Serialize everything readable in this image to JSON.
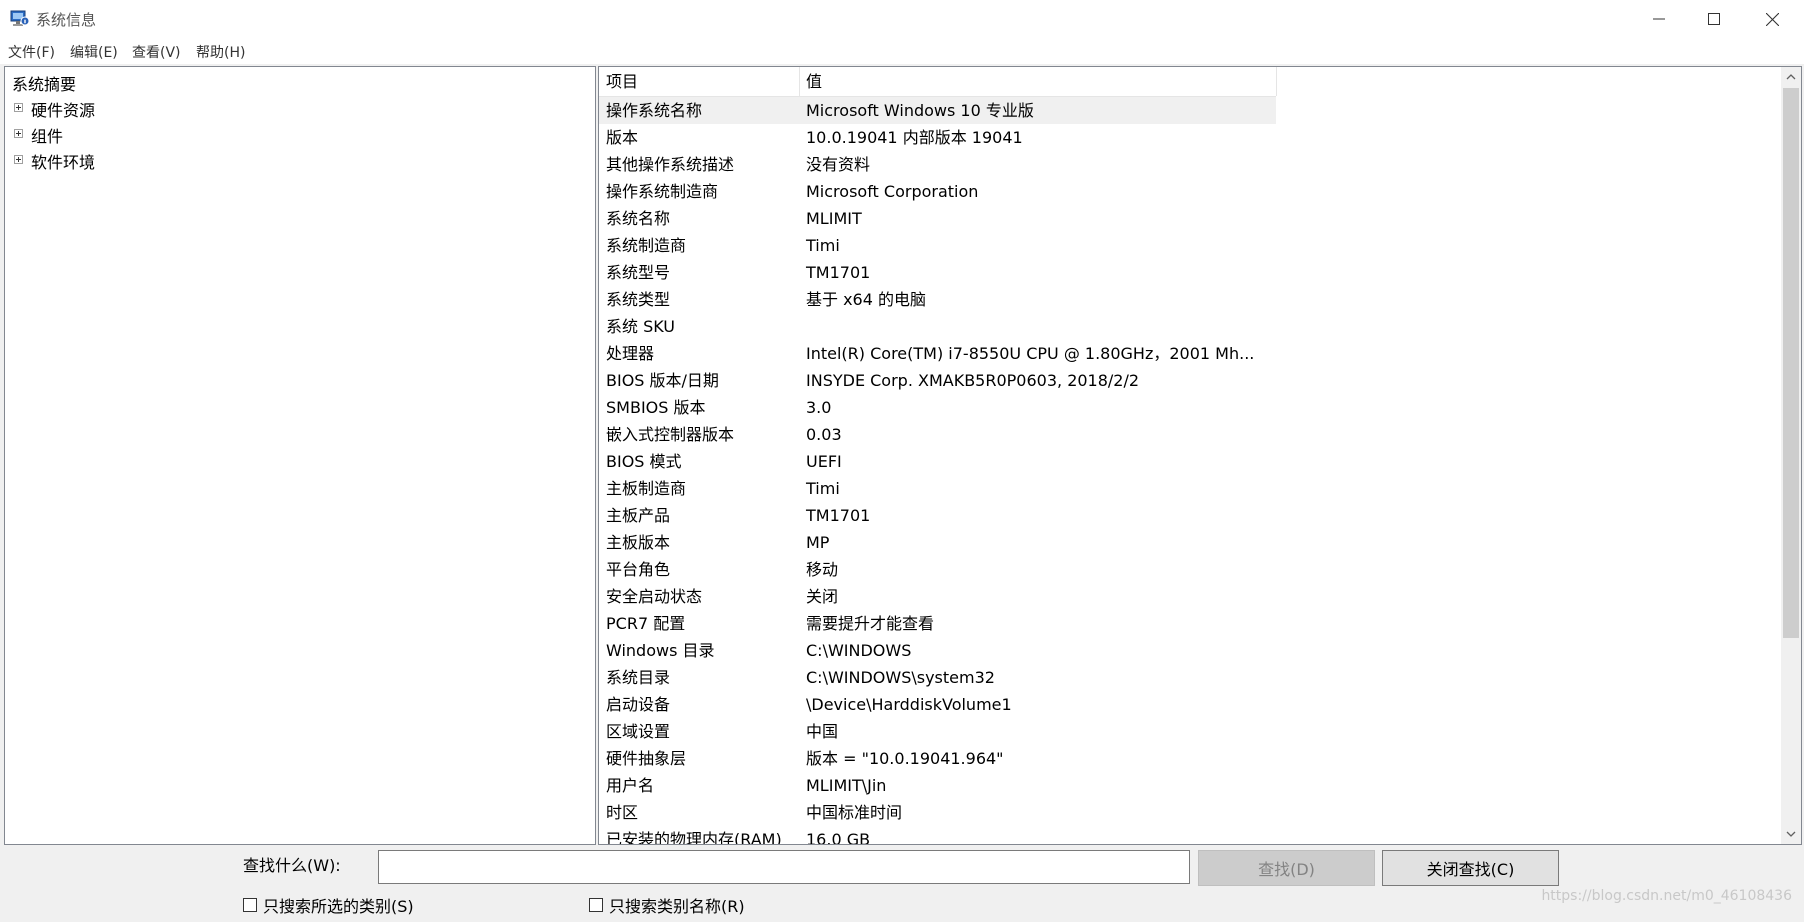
{
  "window": {
    "title": "系统信息"
  },
  "menu": [
    "文件(F)",
    "编辑(E)",
    "查看(V)",
    "帮助(H)"
  ],
  "tree": {
    "root": "系统摘要",
    "children": [
      "硬件资源",
      "组件",
      "软件环境"
    ]
  },
  "list": {
    "columns": [
      "项目",
      "值"
    ],
    "rows": [
      {
        "item": "操作系统名称",
        "value": "Microsoft Windows 10 专业版"
      },
      {
        "item": "版本",
        "value": "10.0.19041 内部版本 19041"
      },
      {
        "item": "其他操作系统描述",
        "value": "没有资料"
      },
      {
        "item": "操作系统制造商",
        "value": "Microsoft Corporation"
      },
      {
        "item": "系统名称",
        "value": "MLIMIT"
      },
      {
        "item": "系统制造商",
        "value": "Timi"
      },
      {
        "item": "系统型号",
        "value": "TM1701"
      },
      {
        "item": "系统类型",
        "value": "基于 x64 的电脑"
      },
      {
        "item": "系统 SKU",
        "value": ""
      },
      {
        "item": "处理器",
        "value": "Intel(R) Core(TM) i7-8550U CPU @ 1.80GHz，2001 Mh..."
      },
      {
        "item": "BIOS 版本/日期",
        "value": "INSYDE Corp. XMAKB5R0P0603, 2018/2/2"
      },
      {
        "item": "SMBIOS 版本",
        "value": "3.0"
      },
      {
        "item": "嵌入式控制器版本",
        "value": "0.03"
      },
      {
        "item": "BIOS 模式",
        "value": "UEFI"
      },
      {
        "item": "主板制造商",
        "value": "Timi"
      },
      {
        "item": "主板产品",
        "value": "TM1701"
      },
      {
        "item": "主板版本",
        "value": "MP"
      },
      {
        "item": "平台角色",
        "value": "移动"
      },
      {
        "item": "安全启动状态",
        "value": "关闭"
      },
      {
        "item": "PCR7 配置",
        "value": "需要提升才能查看"
      },
      {
        "item": "Windows 目录",
        "value": "C:\\WINDOWS"
      },
      {
        "item": "系统目录",
        "value": "C:\\WINDOWS\\system32"
      },
      {
        "item": "启动设备",
        "value": "\\Device\\HarddiskVolume1"
      },
      {
        "item": "区域设置",
        "value": "中国"
      },
      {
        "item": "硬件抽象层",
        "value": "版本 = \"10.0.19041.964\""
      },
      {
        "item": "用户名",
        "value": "MLIMIT\\Jin"
      },
      {
        "item": "时区",
        "value": "中国标准时间"
      },
      {
        "item": "已安装的物理内存(RAM)",
        "value": "16.0 GB"
      }
    ]
  },
  "find": {
    "label": "查找什么(W):",
    "value": "",
    "find_button": "查找(D)",
    "close_button": "关闭查找(C)",
    "check_selected_label": "只搜索所选的类别(S)",
    "check_names_label": "只搜索类别名称(R)"
  },
  "watermark": "https://blog.csdn.net/m0_46108436"
}
